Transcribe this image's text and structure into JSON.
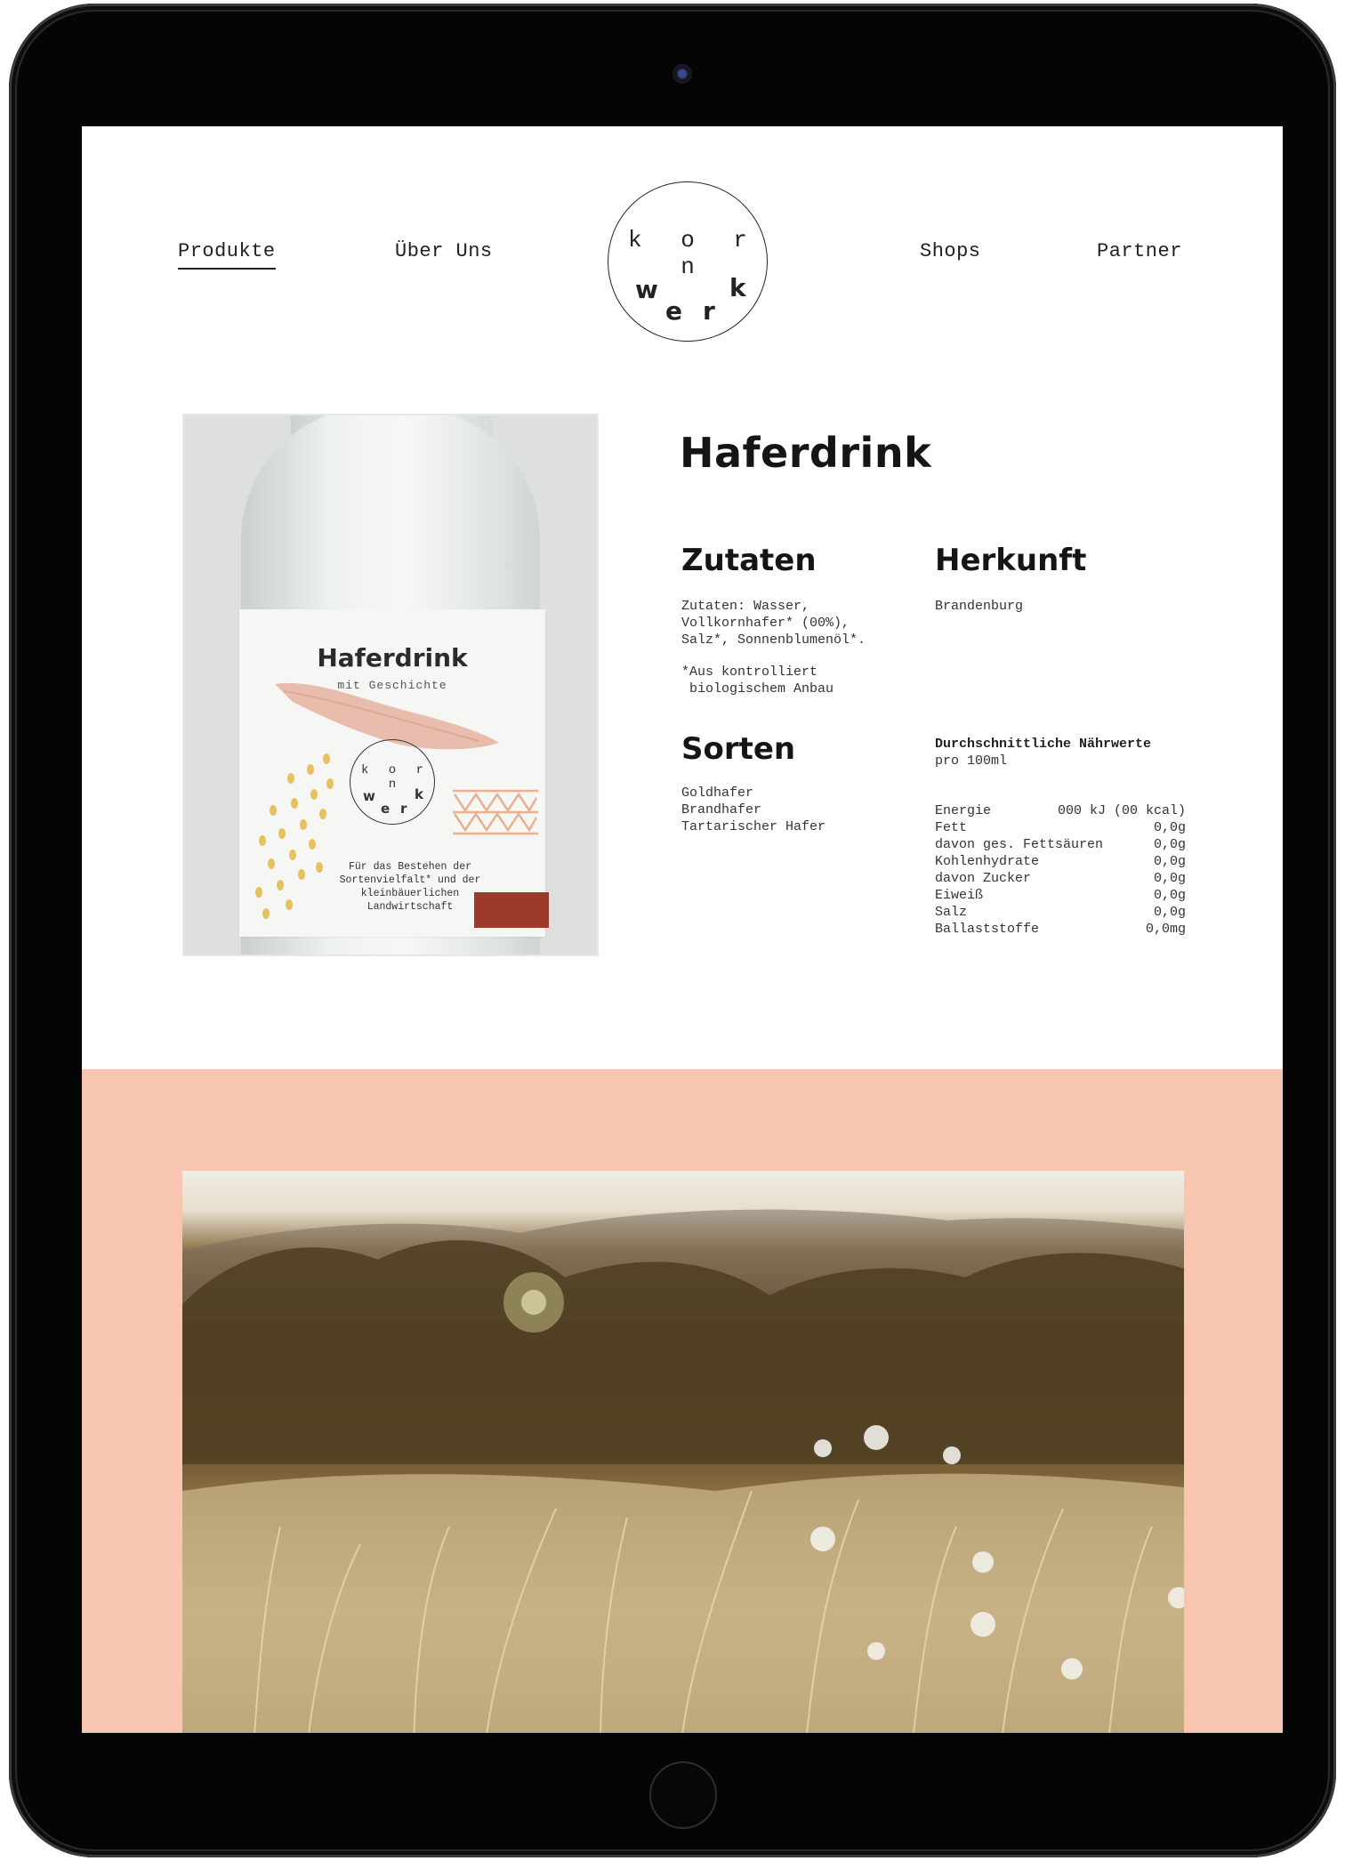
{
  "nav": {
    "left": [
      "Produkte",
      "Über Uns"
    ],
    "right": [
      "Shops",
      "Partner"
    ],
    "active": "Produkte"
  },
  "logo": {
    "top": "k o r n",
    "letters": [
      "w",
      "e",
      "r",
      "k"
    ]
  },
  "product": {
    "title": "Haferdrink",
    "image_label": {
      "title": "Haferdrink",
      "subtitle": "mit Geschichte",
      "logo_top": "k o r n",
      "logo_letters": [
        "w",
        "e",
        "r",
        "k"
      ],
      "text": "Für das Bestehen der Sortenvielfalt* und der kleinbäuerlichen Landwirtschaft"
    },
    "zutaten": {
      "heading": "Zutaten",
      "text": "Zutaten: Wasser,\nVollkornhafer* (00%),\nSalz*, Sonnenblumenöl*.",
      "note": "*Aus kontrolliert\n biologischem Anbau"
    },
    "herkunft": {
      "heading": "Herkunft",
      "text": "Brandenburg"
    },
    "sorten": {
      "heading": "Sorten",
      "items": "Goldhafer\nBrandhafer\nTartarischer Hafer"
    },
    "naehrwerte": {
      "title": "Durchschnittliche Nährwerte",
      "subtitle": "pro 100ml",
      "rows": [
        {
          "label": "Energie",
          "value": "000 kJ (00 kcal)"
        },
        {
          "label": "Fett",
          "value": "0,0g"
        },
        {
          "label": "davon ges. Fettsäuren",
          "value": "0,0g"
        },
        {
          "label": "Kohlenhydrate",
          "value": "0,0g"
        },
        {
          "label": "davon Zucker",
          "value": "0,0g"
        },
        {
          "label": "Eiweiß",
          "value": "0,0g"
        },
        {
          "label": "Salz",
          "value": "0,0g"
        },
        {
          "label": "Ballaststoffe",
          "value": "0,0mg"
        }
      ]
    }
  },
  "colors": {
    "hero_background": "#f7c5b0",
    "label_brush": "#e8b7a6",
    "label_dots": "#e6c25e",
    "label_block": "#9c3a2b"
  }
}
